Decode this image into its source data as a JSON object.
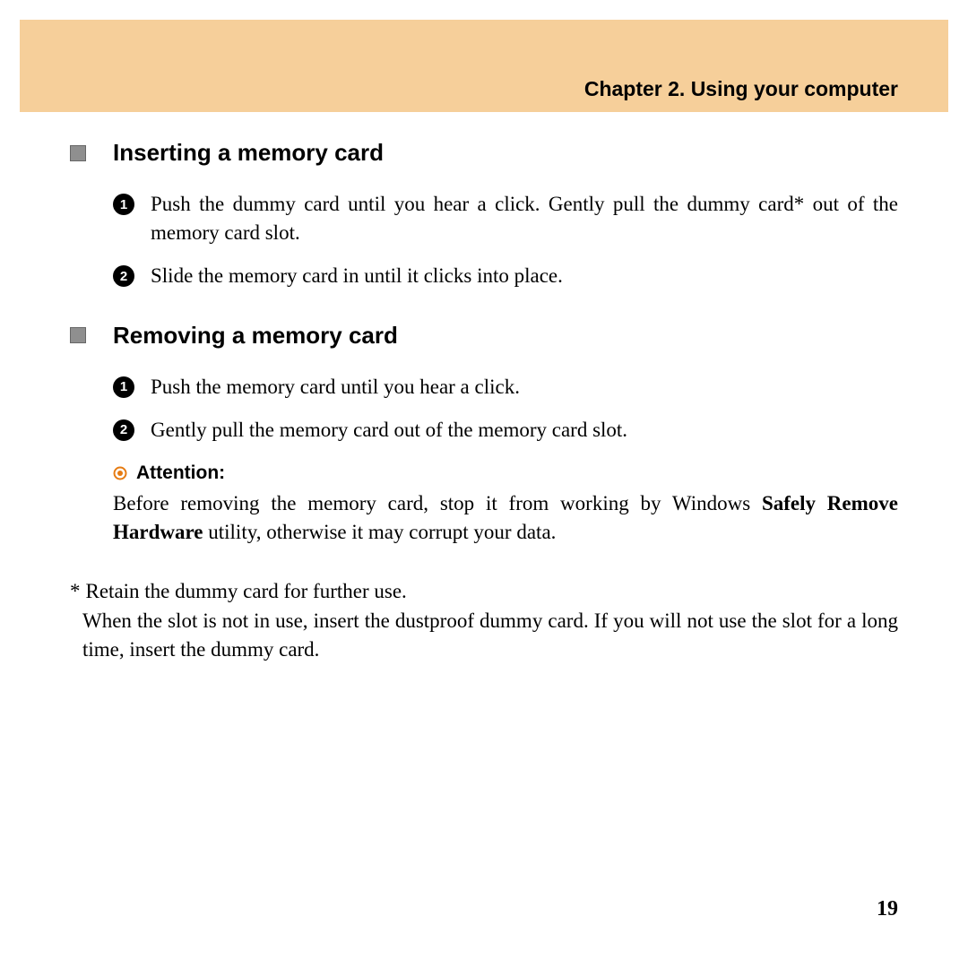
{
  "chapter": "Chapter 2. Using your computer",
  "section1": {
    "title": "Inserting a memory card",
    "steps": [
      "Push the dummy card until you hear a click. Gently pull the dummy card* out of the memory card slot.",
      "Slide the memory card in until it clicks into place."
    ]
  },
  "section2": {
    "title": "Removing a memory card",
    "steps": [
      "Push the memory card until you hear a click.",
      "Gently pull the memory card out of the memory card slot."
    ]
  },
  "attention": {
    "label": "Attention:",
    "text_pre": "Before removing the memory card, stop it from working by Windows ",
    "bold": "Safely Remove Hardware",
    "text_post": " utility, otherwise it may corrupt your data."
  },
  "footnote": {
    "mark": "*",
    "line1": "Retain the dummy card for further use.",
    "line2": "When the slot is not in use, insert the dustproof dummy card. If you will  not use the slot for a long time, insert the dummy card."
  },
  "page_number": "19",
  "step_nums": [
    "1",
    "2"
  ]
}
